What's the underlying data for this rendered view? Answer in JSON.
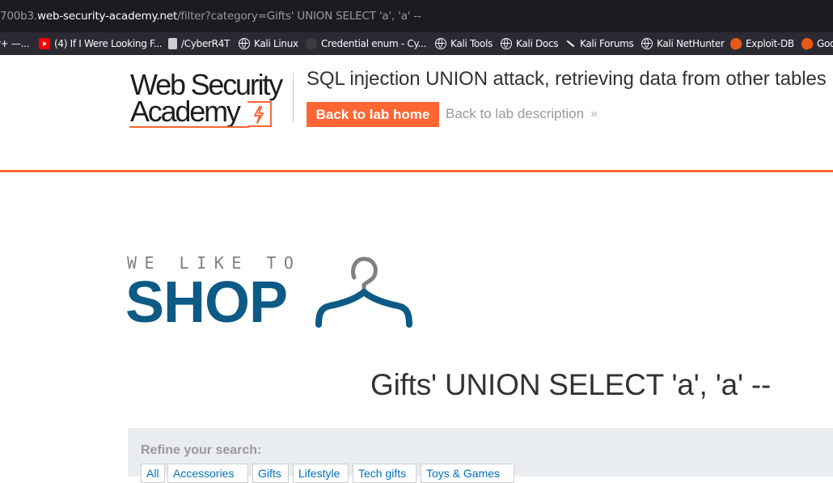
{
  "browser": {
    "url_prefix": "700b3.",
    "url_domain": "web-security-academy.net",
    "url_path": "/filter?category=Gifts' UNION SELECT 'a', 'a' --",
    "bookmarks": [
      {
        "label": "r+ —...",
        "icon": "none"
      },
      {
        "label": "(4) If I Were Looking F...",
        "icon": "youtube-icon"
      },
      {
        "label": "/CyberR4T",
        "icon": "document-icon"
      },
      {
        "label": "Kali Linux",
        "icon": "globe-icon"
      },
      {
        "label": "Credential enum - Cy...",
        "icon": "credential-icon"
      },
      {
        "label": "Kali Tools",
        "icon": "globe-icon"
      },
      {
        "label": "Kali Docs",
        "icon": "globe-icon"
      },
      {
        "label": "Kali Forums",
        "icon": "kali-dragon-icon"
      },
      {
        "label": "Kali NetHunter",
        "icon": "globe-icon"
      },
      {
        "label": "Exploit-DB",
        "icon": "exploitdb-icon"
      },
      {
        "label": "Goo",
        "icon": "exploitdb-icon"
      }
    ]
  },
  "header": {
    "logo_line1": "Web Security",
    "logo_line2": "Academy",
    "lab_title": "SQL injection UNION attack, retrieving data from other tables",
    "back_home_label": "Back to lab home",
    "back_desc_label": "Back to lab description",
    "back_desc_chevron": "»",
    "accent_color": "#ff6633"
  },
  "shop": {
    "tagline": "WE LIKE TO",
    "wordmark": "SHOP",
    "brand_color": "#0d5a86"
  },
  "category": {
    "heading": "Gifts' UNION SELECT 'a', 'a' --"
  },
  "refine": {
    "label": "Refine your search:",
    "filters": [
      "All",
      "Accessories",
      "Gifts",
      "Lifestyle",
      "Tech gifts",
      "Toys & Games"
    ]
  }
}
